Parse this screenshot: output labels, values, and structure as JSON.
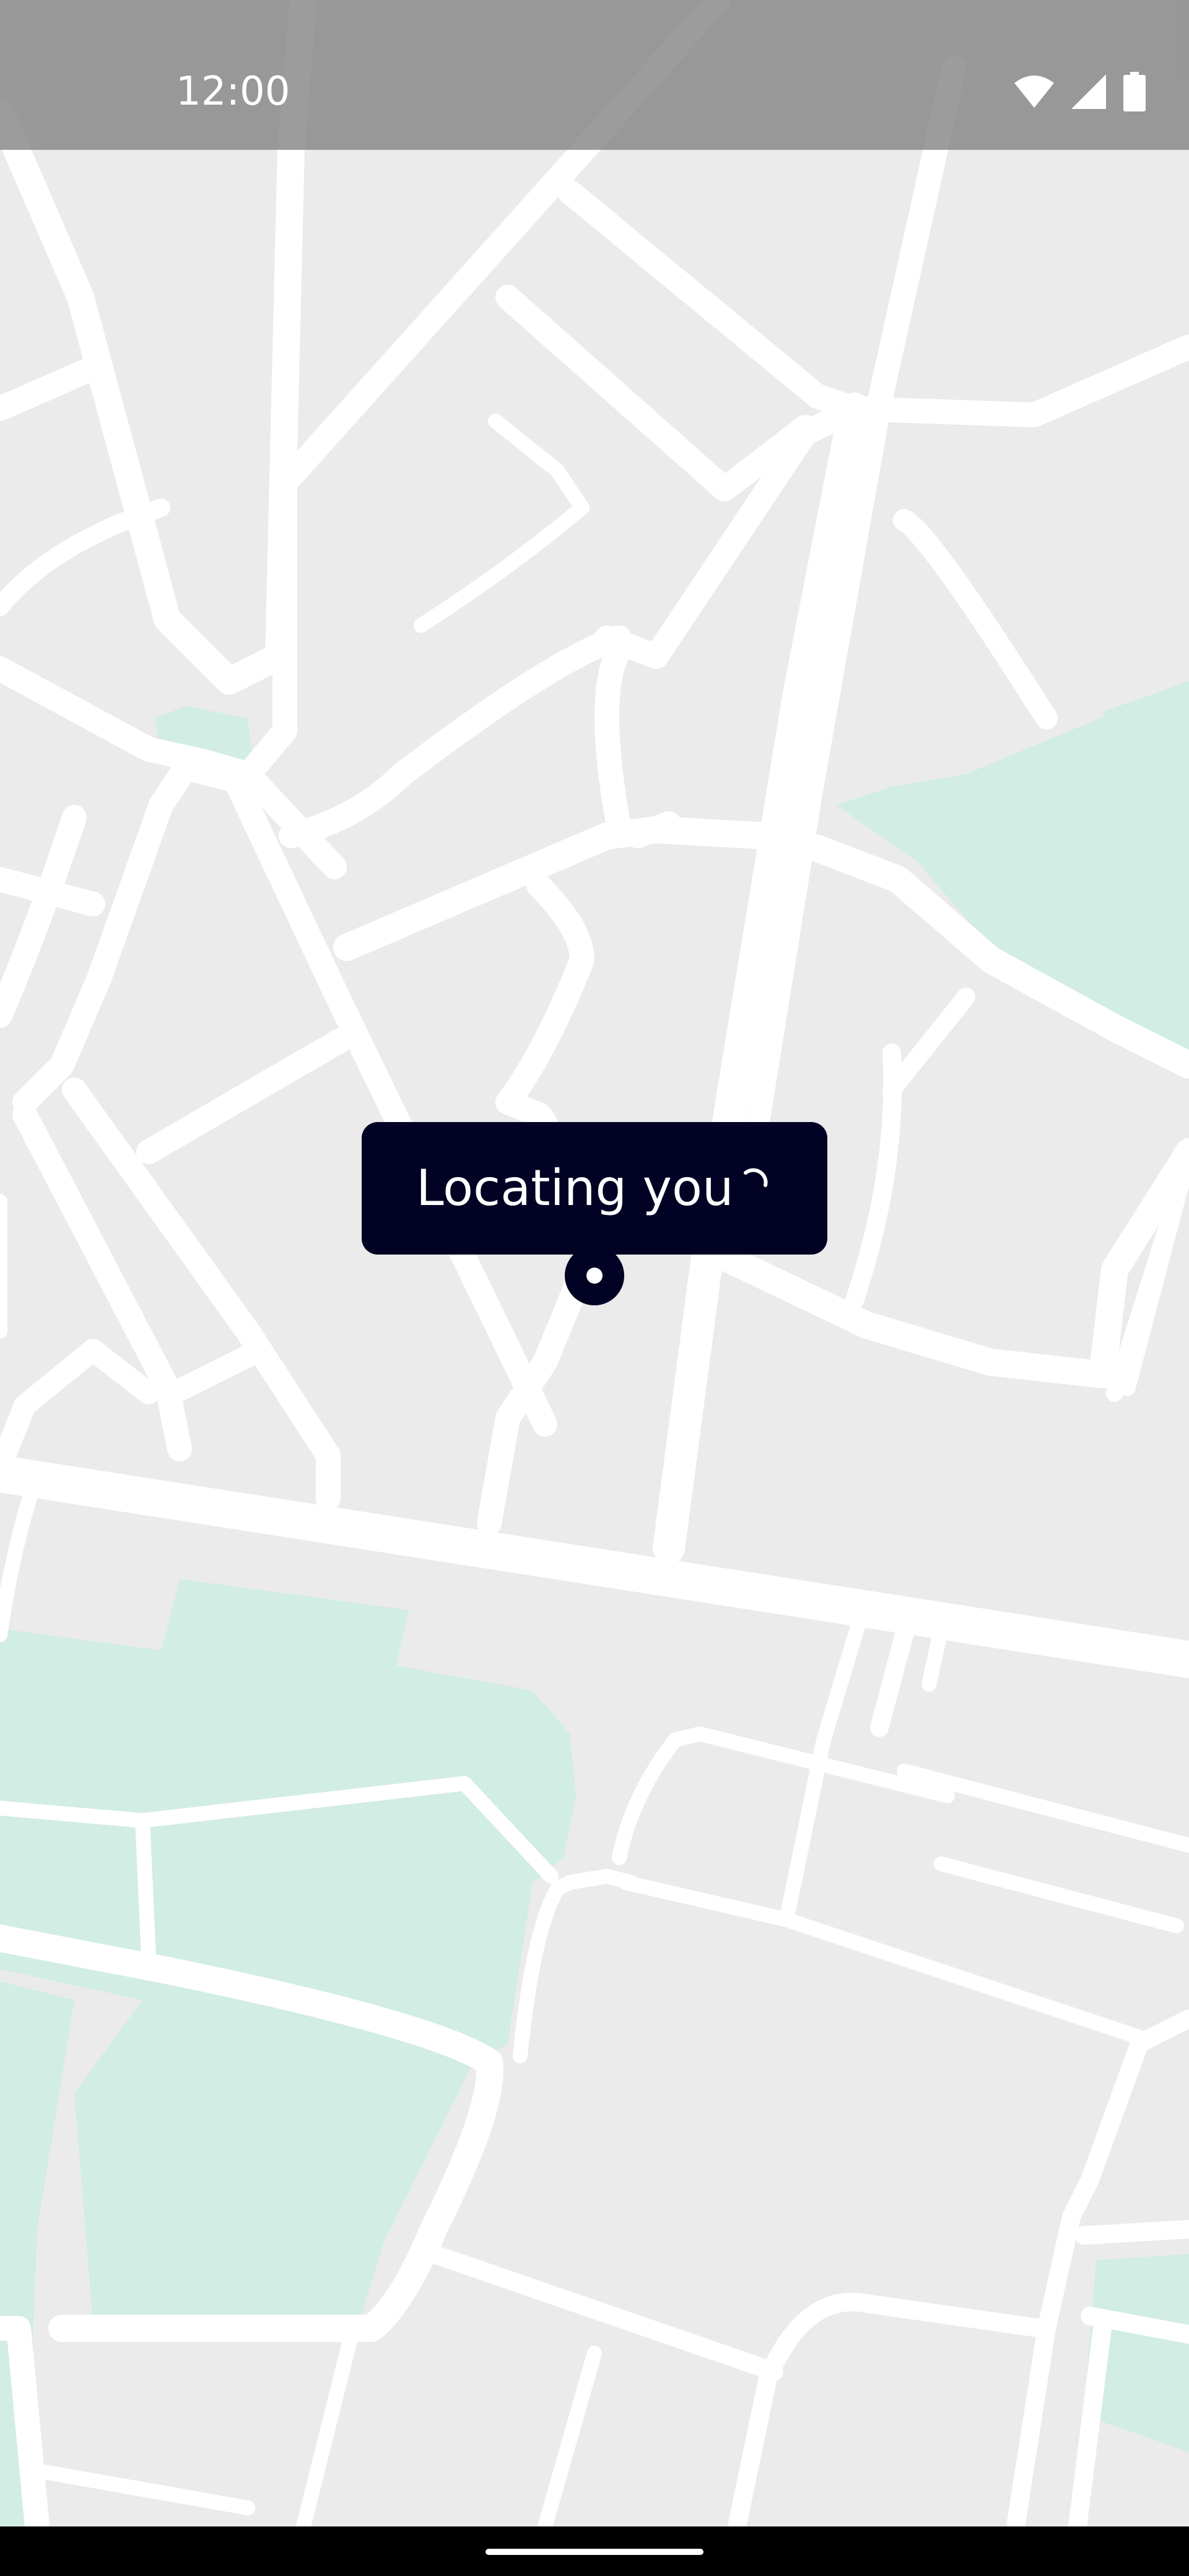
{
  "status_bar": {
    "time": "12:00",
    "icons": [
      "wifi-icon",
      "cellular-signal-icon",
      "battery-icon"
    ]
  },
  "map": {
    "tooltip_text": "Locating you",
    "loading": true,
    "colors": {
      "background": "#ebebeb",
      "road": "#ffffff",
      "park": "#d2ede3",
      "tooltip": "#010224"
    }
  },
  "navigation_bar": {
    "handle": "home-gesture-handle"
  }
}
